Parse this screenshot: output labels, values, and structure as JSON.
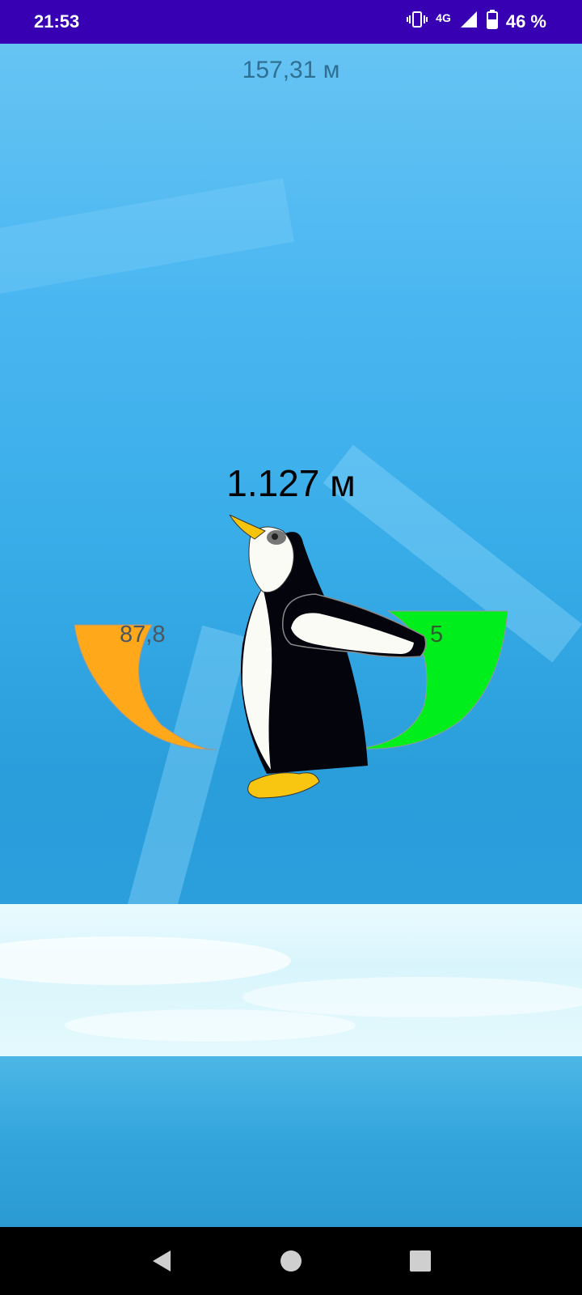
{
  "status_bar": {
    "time": "21:53",
    "network": "4G",
    "battery": "46 %",
    "icons": [
      "vibrate-icon",
      "signal-icon",
      "battery-icon"
    ]
  },
  "game": {
    "height_readout": "157,31 м",
    "distance_readout": "1.127 м",
    "left_gauge": {
      "value": "87,8",
      "color": "#ffa819"
    },
    "right_gauge": {
      "value": "5",
      "color": "#00ee1c"
    }
  },
  "nav_bar": {
    "icons": [
      "back-icon",
      "home-icon",
      "recents-icon"
    ]
  }
}
